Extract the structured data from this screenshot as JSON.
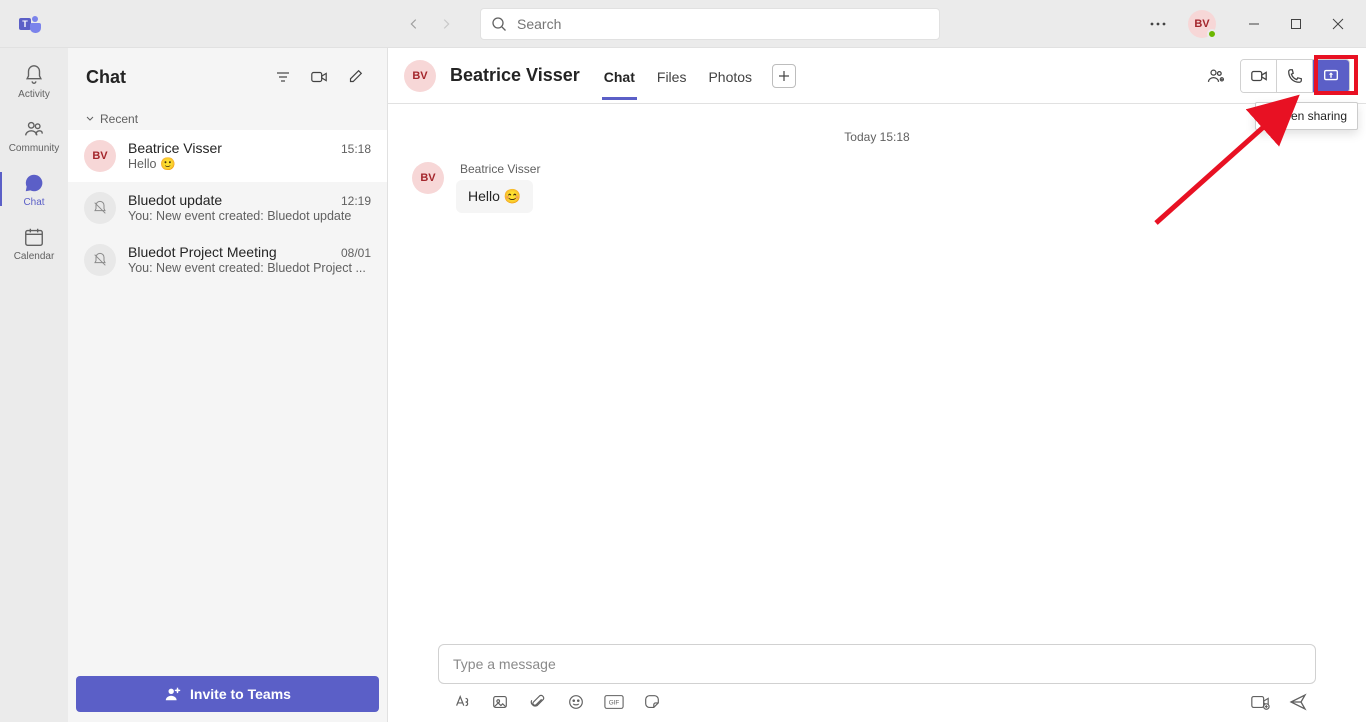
{
  "titlebar": {
    "search_placeholder": "Search",
    "avatar_initials": "BV"
  },
  "rail": {
    "items": [
      {
        "id": "activity",
        "label": "Activity"
      },
      {
        "id": "community",
        "label": "Community"
      },
      {
        "id": "chat",
        "label": "Chat"
      },
      {
        "id": "calendar",
        "label": "Calendar"
      }
    ]
  },
  "chatlist": {
    "title": "Chat",
    "recent_label": "Recent",
    "invite_label": "Invite to Teams",
    "items": [
      {
        "name": "Beatrice Visser",
        "preview": "Hello 🙂",
        "time": "15:18",
        "avatar": "BV",
        "avatarClass": "pink"
      },
      {
        "name": "Bluedot update",
        "preview": "You: New event created: Bluedot update",
        "time": "12:19",
        "avatar": "bell",
        "avatarClass": "gray"
      },
      {
        "name": "Bluedot Project Meeting",
        "preview": "You: New event created: Bluedot Project ...",
        "time": "08/01",
        "avatar": "bell",
        "avatarClass": "gray"
      }
    ]
  },
  "conversation": {
    "title": "Beatrice Visser",
    "avatar_initials": "BV",
    "tabs": [
      "Chat",
      "Files",
      "Photos"
    ],
    "active_tab": 0,
    "date_separator": "Today 15:18",
    "tooltip": "Screen sharing",
    "messages": [
      {
        "sender": "Beatrice Visser",
        "text": "Hello 😊",
        "avatar": "BV"
      }
    ],
    "composer_placeholder": "Type a message"
  }
}
